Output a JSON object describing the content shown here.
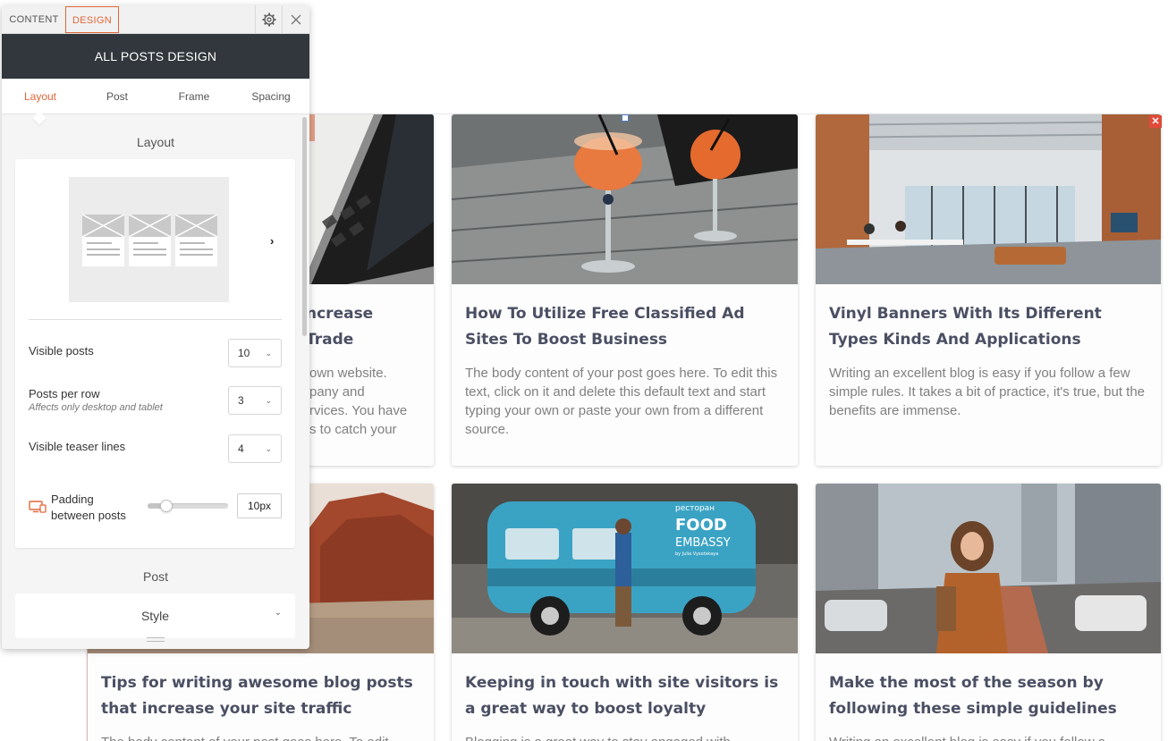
{
  "panel": {
    "top_tabs": {
      "content": "CONTENT",
      "design": "DESIGN"
    },
    "settings_icon": "gear-icon",
    "close_icon": "close-icon",
    "header_title": "ALL POSTS DESIGN",
    "sub_tabs": [
      "Layout",
      "Post",
      "Frame",
      "Spacing"
    ],
    "active_sub_tab": "Layout",
    "layout_heading": "Layout",
    "layout_next_icon": "chevron-right-icon",
    "options": {
      "visible_posts": {
        "label": "Visible posts",
        "value": "10"
      },
      "posts_per_row": {
        "label": "Posts per row",
        "sublabel": "Affects only desktop and tablet",
        "value": "3"
      },
      "teaser_lines": {
        "label": "Visible teaser lines",
        "value": "4"
      },
      "padding": {
        "label_line1": "Padding",
        "label_line2": "between posts",
        "value": "10px",
        "slider_fraction": 0.18,
        "device_icon": "desktop-tablet-icon"
      }
    },
    "post_heading": "Post",
    "style_label": "Style",
    "style_chevron_icon": "chevron-down-icon"
  },
  "posts": [
    {
      "title_visible": "ncrease Trade",
      "body_visible": [
        "own website.",
        "pany and",
        "rvices. You have",
        "s to catch your"
      ],
      "image": "laptop-keyboard-photo"
    },
    {
      "title": "How To Utilize Free Classified Ad Sites To Boost Business",
      "body": "The body content of your post goes here. To edit this text, click on it and delete this default text and start typing your own or paste your own from a different source.",
      "image": "cocktails-on-wooden-table-photo"
    },
    {
      "title": "Vinyl Banners With Its Different Types Kinds And Applications",
      "body": "Writing an excellent blog is easy if you follow a few simple rules. It takes a bit of practice, it's true, but the benefits are immense.",
      "image": "open-plan-office-photo"
    },
    {
      "title": "Tips for writing awesome blog posts that increase your site traffic",
      "body": "The body content of your post goes here. To edit",
      "image": "desert-red-rocks-photo"
    },
    {
      "title": "Keeping in touch with site visitors is a great way to boost loyalty",
      "body": "Blogging is a great way to stay engaged with",
      "image": "blue-food-van-photo",
      "van_text": [
        "ресторан",
        "FOOD",
        "EMBASSY",
        "by Julia Vysotskaya"
      ]
    },
    {
      "title": "Make the most of the season by following these simple guidelines",
      "body": "Writing an excellent blog is easy if you follow a",
      "image": "woman-in-city-street-photo"
    }
  ],
  "colors": {
    "accent": "#e06639",
    "header_bg": "#31373c",
    "title_text": "#4b4f63",
    "body_text": "#808080",
    "close_red": "#e24a3b"
  }
}
